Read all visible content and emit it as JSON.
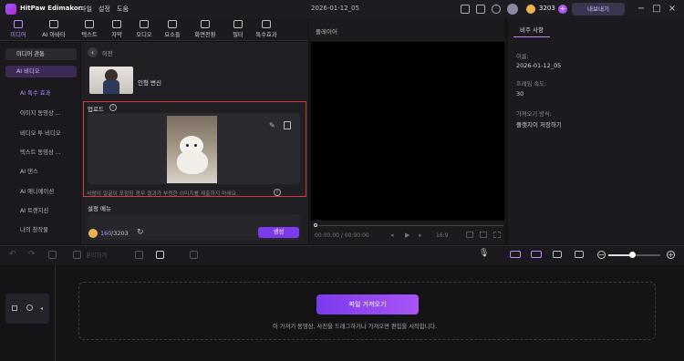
{
  "app": {
    "title": "HitPaw Edimakor",
    "menu": [
      "파일",
      "설정",
      "도움"
    ],
    "project_name": "2026-01-12_05",
    "credits": "3203",
    "export_label": "내보내기"
  },
  "toolbar": {
    "items": [
      {
        "label": "미디어",
        "active": true
      },
      {
        "label": "AI 아바타",
        "active": false
      },
      {
        "label": "텍스트",
        "active": false
      },
      {
        "label": "자막",
        "active": false
      },
      {
        "label": "오디오",
        "active": false
      },
      {
        "label": "요소들",
        "active": false
      },
      {
        "label": "화면전환",
        "active": false
      },
      {
        "label": "필터",
        "active": false
      },
      {
        "label": "특수효과",
        "active": false
      }
    ]
  },
  "sidebar": {
    "dropdown_1": "미디어 관통",
    "dropdown_2": "AI 비디오",
    "items": [
      "AI 특수 효과",
      "이미지 동영상 ...",
      "비디오 투 비디오",
      "텍스트 동영상 ...",
      "AI 댄스",
      "AI 애니메이션",
      "AI 트랜지션",
      "나의 창작물"
    ],
    "selected_index": 0
  },
  "main": {
    "back_label": "이전",
    "effect_name": "인형 변신",
    "upload_title": "업로드",
    "upload_hint": "사람이 얼굴이 포함된 경우 결과가 부정한 이미지를 제출하지 마세요.",
    "settings_title": "설정 메뉴",
    "credit_used": "160",
    "credit_total": "/3203",
    "generate_label": "생성"
  },
  "player": {
    "title": "플레이어",
    "time": "00:00:00 / 00:00:00",
    "speed": "16:9"
  },
  "props": {
    "tab": "비주 사항",
    "name_label": "이름:",
    "name_value": "2026-01-12_05",
    "fps_label": "프레임 속도:",
    "fps_value": "30",
    "source_label": "가져오기 방식:",
    "source_value": "플랫지이 저장하기"
  },
  "timeline": {
    "toolbar_text": "분리하기",
    "zoom_level": 0.47,
    "import_label": "파일 가져오기",
    "drop_hint": "이 가져기 동영상, 사진을 드래그하거나 가져오면 편집을 시작합니다."
  },
  "colors": {
    "accent": "#b98cff",
    "highlight_box": "#d8383a",
    "primary_button": "#7c3aed"
  }
}
